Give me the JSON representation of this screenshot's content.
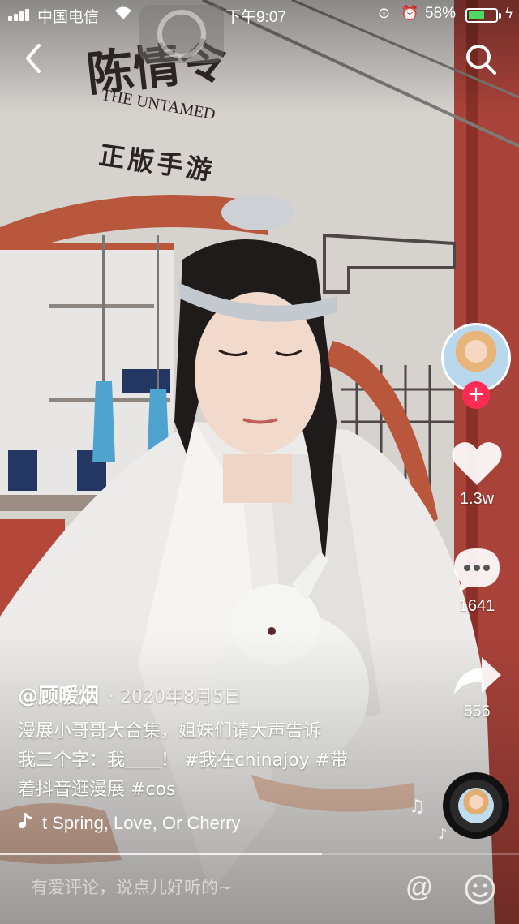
{
  "status_bar": {
    "carrier": "中国电信",
    "time": "下午9:07",
    "battery_percent": "58%",
    "battery_level": 0.58
  },
  "background_overlay": {
    "logo_title": "陈情令",
    "logo_subtitle": "THE UNTAMED",
    "logo_tagline": "正版手游"
  },
  "actions": {
    "like_count": "1.3w",
    "comment_count": "1641",
    "share_count": "556"
  },
  "post": {
    "author": "@顾暖烟",
    "date": "· 2020年8月5日",
    "caption_line1": "漫展小哥哥大合集，姐妹们请大声告诉",
    "caption_line2": "我三个字：我＿＿！ #我在chinajoy #带",
    "caption_line3": "着抖音逛漫展 #cos",
    "music": "t Spring, Love, Or Cherry",
    "progress": 0.62
  },
  "comment_bar": {
    "placeholder": "有爱评论，说点儿好听的~",
    "at_symbol": "@"
  },
  "colors": {
    "accent": "#fe2c55",
    "battery": "#4cd964"
  },
  "icons": [
    "back-icon",
    "search-icon",
    "plus-icon",
    "heart-icon",
    "comment-icon",
    "share-icon",
    "music-note-icon",
    "emoji-icon",
    "wifi-icon",
    "signal-icon"
  ]
}
